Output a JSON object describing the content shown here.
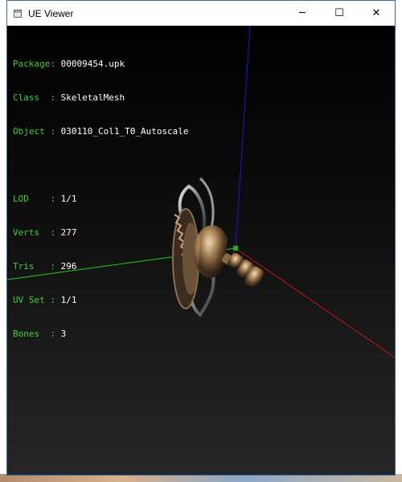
{
  "window": {
    "title": "UE Viewer",
    "minimize_glyph": "─",
    "maximize_glyph": "☐",
    "close_glyph": "✕"
  },
  "mesh_info": {
    "package_key": "Package:",
    "package_val": "00009454.upk",
    "class_key": "Class  :",
    "class_val": "SkeletalMesh",
    "object_key": "Object :",
    "object_val": "030110_Col1_T0_Autoscale",
    "lod_key": "LOD    :",
    "lod_val": "1/1",
    "verts_key": "Verts  :",
    "verts_val": "277",
    "tris_key": "Tris   :",
    "tris_val": "296",
    "uvset_key": "UV Set :",
    "uvset_val": "1/1",
    "bones_key": "Bones  :",
    "bones_val": "3"
  },
  "colors": {
    "info_key": "#3cd13c",
    "info_value": "#ffffff",
    "axis_x": "#cc1111",
    "axis_y": "#22cc22",
    "axis_z": "#1a1acc"
  },
  "icons": [
    "app-window-icon",
    "minimize-icon",
    "maximize-icon",
    "close-icon"
  ]
}
